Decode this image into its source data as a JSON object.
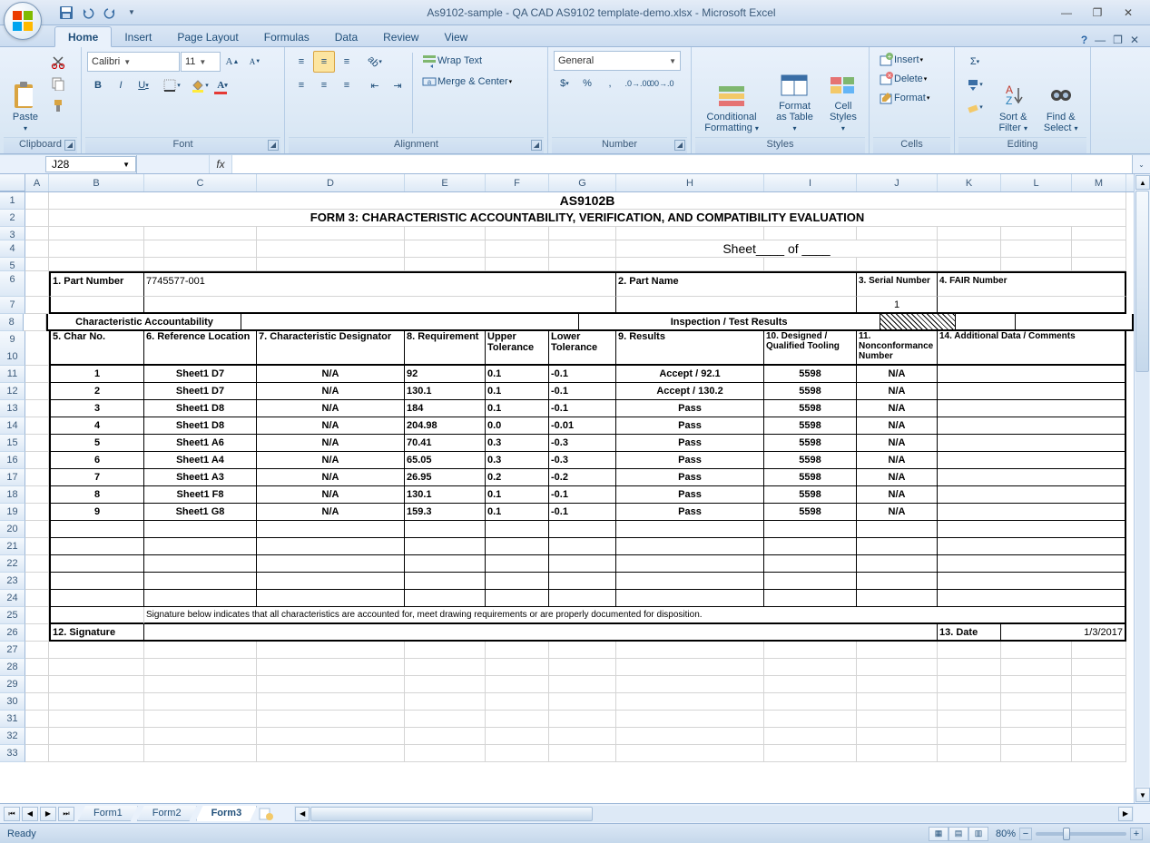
{
  "titlebar": {
    "title": "As9102-sample - QA CAD AS9102 template-demo.xlsx - Microsoft Excel",
    "minimize": "—",
    "restore": "❐",
    "close": "✕"
  },
  "tabs": {
    "home": "Home",
    "insert": "Insert",
    "pagelayout": "Page Layout",
    "formulas": "Formulas",
    "data": "Data",
    "review": "Review",
    "view": "View"
  },
  "ribbon": {
    "clipboard": {
      "label": "Clipboard",
      "paste": "Paste"
    },
    "font": {
      "label": "Font",
      "name": "Calibri",
      "size": "11",
      "bold": "B",
      "italic": "I",
      "underline": "U"
    },
    "alignment": {
      "label": "Alignment",
      "wrap": "Wrap Text",
      "merge": "Merge & Center"
    },
    "number": {
      "label": "Number",
      "format": "General"
    },
    "styles": {
      "label": "Styles",
      "cond": "Conditional Formatting",
      "table": "Format as Table",
      "cell": "Cell Styles"
    },
    "cells": {
      "label": "Cells",
      "insert": "Insert",
      "delete": "Delete",
      "format": "Format"
    },
    "editing": {
      "label": "Editing",
      "sort": "Sort & Filter",
      "find": "Find & Select"
    }
  },
  "fx": {
    "cell": "J28",
    "fx": "fx"
  },
  "columns": [
    "A",
    "B",
    "C",
    "D",
    "E",
    "F",
    "G",
    "H",
    "I",
    "J",
    "K",
    "L",
    "M"
  ],
  "form": {
    "title": "AS9102B",
    "subtitle": "FORM 3: CHARACTERISTIC ACCOUNTABILITY, VERIFICATION, AND COMPATIBILITY EVALUATION",
    "sheet_of": "Sheet____ of ____",
    "h_partnum": "1. Part Number",
    "partnum": "7745577-001",
    "h_partname": "2. Part Name",
    "h_serial": "3. Serial Number",
    "serial": "1",
    "h_fair": "4. FAIR Number",
    "sec_char": "Characteristic Accountability",
    "sec_insp": "Inspection / Test Results",
    "h5": "5. Char No.",
    "h6": "6. Reference Location",
    "h7": "7. Characteristic Designator",
    "h8": "8. Requirement",
    "h_ut": "Upper Tolerance",
    "h_lt": "Lower Tolerance",
    "h9": "9. Results",
    "h10": "10. Designed / Qualified Tooling",
    "h11": "11. Nonconformance Number",
    "h14": "14. Additional Data / Comments",
    "sig_note": "Signature below indicates that all characteristics are accounted for, meet drawing requirements or are properly documented for disposition.",
    "h12": "12. Signature",
    "h13": "13. Date",
    "date": "1/3/2017",
    "rows": [
      {
        "n": "1",
        "ref": "Sheet1  D7",
        "des": "N/A",
        "req": "92",
        "ut": "0.1",
        "lt": "-0.1",
        "res": "Accept / 92.1",
        "tool": "5598",
        "nc": "N/A"
      },
      {
        "n": "2",
        "ref": "Sheet1  D7",
        "des": "N/A",
        "req": "130.1",
        "ut": "0.1",
        "lt": "-0.1",
        "res": "Accept / 130.2",
        "tool": "5598",
        "nc": "N/A"
      },
      {
        "n": "3",
        "ref": "Sheet1  D8",
        "des": "N/A",
        "req": "184",
        "ut": "0.1",
        "lt": "-0.1",
        "res": "Pass",
        "tool": "5598",
        "nc": "N/A"
      },
      {
        "n": "4",
        "ref": "Sheet1  D8",
        "des": "N/A",
        "req": "204.98",
        "ut": "0.0",
        "lt": "-0.01",
        "res": "Pass",
        "tool": "5598",
        "nc": "N/A"
      },
      {
        "n": "5",
        "ref": "Sheet1  A6",
        "des": "N/A",
        "req": "70.41",
        "ut": "0.3",
        "lt": "-0.3",
        "res": "Pass",
        "tool": "5598",
        "nc": "N/A"
      },
      {
        "n": "6",
        "ref": "Sheet1  A4",
        "des": "N/A",
        "req": "65.05",
        "ut": "0.3",
        "lt": "-0.3",
        "res": "Pass",
        "tool": "5598",
        "nc": "N/A"
      },
      {
        "n": "7",
        "ref": "Sheet1  A3",
        "des": "N/A",
        "req": "26.95",
        "ut": "0.2",
        "lt": "-0.2",
        "res": "Pass",
        "tool": "5598",
        "nc": "N/A"
      },
      {
        "n": "8",
        "ref": "Sheet1  F8",
        "des": "N/A",
        "req": "130.1",
        "ut": "0.1",
        "lt": "-0.1",
        "res": "Pass",
        "tool": "5598",
        "nc": "N/A"
      },
      {
        "n": "9",
        "ref": "Sheet1  G8",
        "des": "N/A",
        "req": "159.3",
        "ut": "0.1",
        "lt": "-0.1",
        "res": "Pass",
        "tool": "5598",
        "nc": "N/A"
      }
    ]
  },
  "sheets": {
    "f1": "Form1",
    "f2": "Form2",
    "f3": "Form3"
  },
  "status": {
    "ready": "Ready",
    "zoom": "80%"
  }
}
